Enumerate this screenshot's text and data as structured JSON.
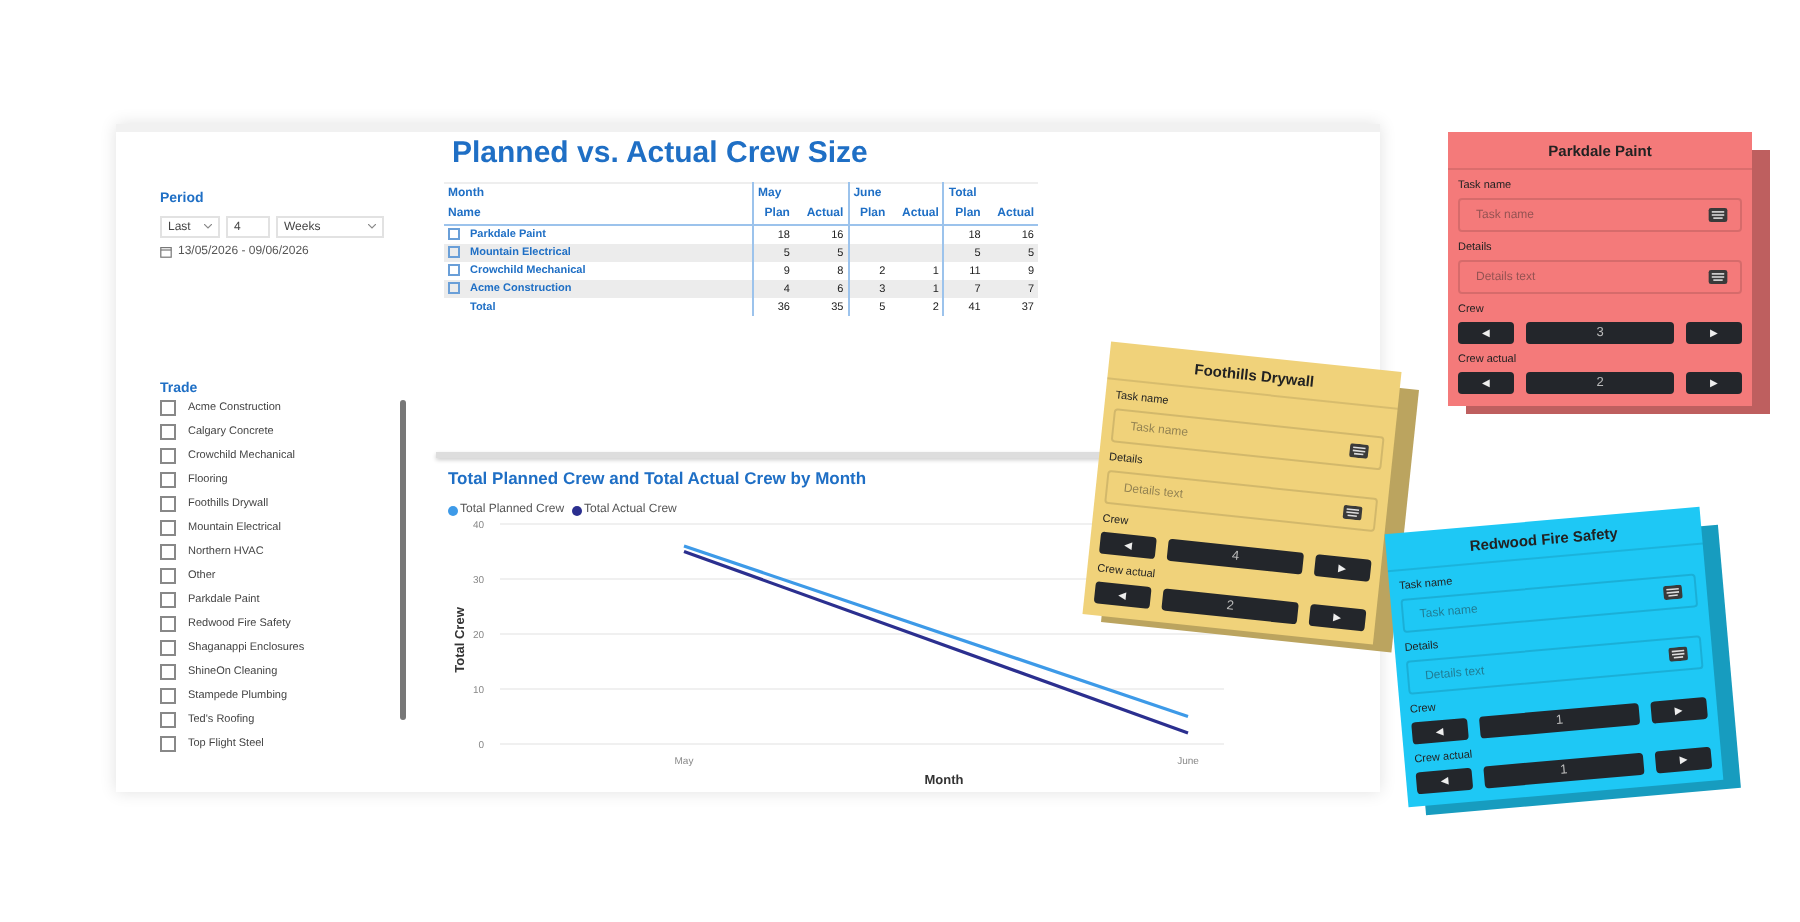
{
  "dashboard": {
    "title": "Planned vs. Actual Crew Size",
    "period": {
      "label": "Period",
      "mode": "Last",
      "count": "4",
      "unit": "Weeks",
      "range": "13/05/2026 - 09/06/2026"
    },
    "trade": {
      "label": "Trade",
      "items": [
        {
          "label": "Acme Construction",
          "checked": false
        },
        {
          "label": "Calgary Concrete",
          "checked": false
        },
        {
          "label": "Crowchild Mechanical",
          "checked": false
        },
        {
          "label": "Flooring",
          "checked": false
        },
        {
          "label": "Foothills Drywall",
          "checked": false
        },
        {
          "label": "Mountain Electrical",
          "checked": false
        },
        {
          "label": "Northern HVAC",
          "checked": false
        },
        {
          "label": "Other",
          "checked": false
        },
        {
          "label": "Parkdale Paint",
          "checked": false
        },
        {
          "label": "Redwood Fire Safety",
          "checked": false
        },
        {
          "label": "Shaganappi Enclosures",
          "checked": false
        },
        {
          "label": "ShineOn Cleaning",
          "checked": false
        },
        {
          "label": "Stampede Plumbing",
          "checked": false
        },
        {
          "label": "Ted's Roofing",
          "checked": false
        },
        {
          "label": "Top Flight Steel",
          "checked": false
        }
      ]
    },
    "table": {
      "header_top": [
        "Month",
        "May",
        "June",
        "Total"
      ],
      "header_bottom": [
        "Name",
        "Plan",
        "Actual",
        "Plan",
        "Actual",
        "Plan",
        "Actual"
      ],
      "rows": [
        {
          "name": "Parkdale Paint",
          "expandable": true,
          "cells": [
            "18",
            "16",
            "",
            "",
            "18",
            "16"
          ]
        },
        {
          "name": "Mountain Electrical",
          "expandable": true,
          "cells": [
            "5",
            "5",
            "",
            "",
            "5",
            "5"
          ]
        },
        {
          "name": "Crowchild Mechanical",
          "expandable": true,
          "cells": [
            "9",
            "8",
            "2",
            "1",
            "11",
            "9"
          ]
        },
        {
          "name": "Acme Construction",
          "expandable": true,
          "cells": [
            "4",
            "6",
            "3",
            "1",
            "7",
            "7"
          ]
        },
        {
          "name": "Total",
          "expandable": false,
          "cells": [
            "36",
            "35",
            "5",
            "2",
            "41",
            "37"
          ]
        }
      ]
    },
    "chart": {
      "title": "Total Planned Crew and Total Actual Crew by Month",
      "chart_data": {
        "type": "line",
        "xlabel": "Month",
        "ylabel": "Total Crew",
        "categories": [
          "May",
          "June"
        ],
        "ylim": [
          0,
          40
        ],
        "grid": true,
        "yticks": [
          0,
          10,
          20,
          30,
          40
        ],
        "series": [
          {
            "name": "Total Planned Crew",
            "color": "#3d9ae8",
            "values": [
              36,
              5
            ]
          },
          {
            "name": "Total Actual Crew",
            "color": "#2b2f8f",
            "values": [
              35,
              2
            ]
          }
        ]
      }
    }
  },
  "cards": [
    {
      "title": "Parkdale Paint",
      "color": "#f47a7a",
      "task_label": "Task name",
      "task_placeholder": "Task name",
      "details_label": "Details",
      "details_placeholder": "Details text",
      "crew_label": "Crew",
      "crew": "3",
      "actual_label": "Crew actual",
      "actual": "2",
      "dec": "◀",
      "inc": "▶"
    },
    {
      "title": "Foothills Drywall",
      "color": "#f0d27a",
      "task_label": "Task name",
      "task_placeholder": "Task name",
      "details_label": "Details",
      "details_placeholder": "Details text",
      "crew_label": "Crew",
      "crew": "4",
      "actual_label": "Crew actual",
      "actual": "2",
      "dec": "◀",
      "inc": "▶"
    },
    {
      "title": "Redwood Fire Safety",
      "color": "#1ec8f5",
      "task_label": "Task name",
      "task_placeholder": "Task name",
      "details_label": "Details",
      "details_placeholder": "Details text",
      "crew_label": "Crew",
      "crew": "1",
      "actual_label": "Crew actual",
      "actual": "1",
      "dec": "◀",
      "inc": "▶"
    }
  ]
}
